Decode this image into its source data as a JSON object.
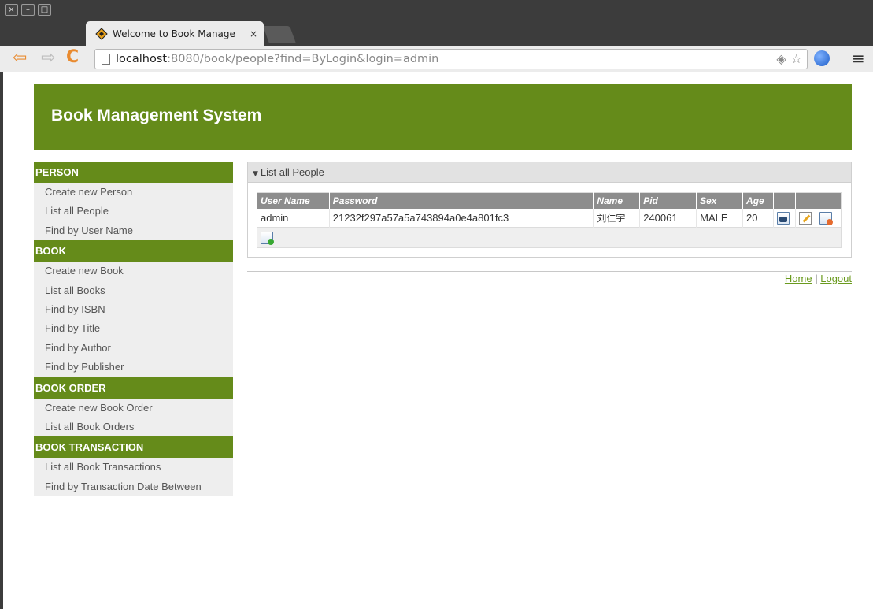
{
  "browser": {
    "window_buttons": [
      "×",
      "–",
      "□"
    ],
    "tab_title": "Welcome to Book Manage",
    "tab_close": "×",
    "url_host": "localhost",
    "url_rest": ":8080/book/people?find=ByLogin&login=admin",
    "menu_glyph": "≡"
  },
  "header": {
    "title": "Book Management System"
  },
  "sidebar": {
    "sections": [
      {
        "title": "PERSON",
        "items": [
          "Create new Person",
          "List all People",
          "Find by User Name"
        ]
      },
      {
        "title": "BOOK",
        "items": [
          "Create new Book",
          "List all Books",
          "Find by ISBN",
          "Find by Title",
          "Find by Author",
          "Find by Publisher"
        ]
      },
      {
        "title": "BOOK ORDER",
        "items": [
          "Create new Book Order",
          "List all Book Orders"
        ]
      },
      {
        "title": "BOOK TRANSACTION",
        "items": [
          "List all Book Transactions",
          "Find by Transaction Date Between"
        ]
      }
    ]
  },
  "panel": {
    "title": "List all People",
    "columns": [
      "User Name",
      "Password",
      "Name",
      "Pid",
      "Sex",
      "Age"
    ],
    "rows": [
      {
        "user_name": "admin",
        "password": "21232f297a57a5a743894a0e4a801fc3",
        "name": "刘仁宇",
        "pid": "240061",
        "sex": "MALE",
        "age": "20"
      }
    ]
  },
  "footer": {
    "home": "Home",
    "separator": "|",
    "logout": "Logout"
  },
  "icons": {
    "back": "back-arrow-icon",
    "forward": "forward-arrow-icon",
    "reload": "reload-icon",
    "show": "show-person-icon",
    "edit": "edit-person-icon",
    "delete": "delete-person-icon",
    "add": "add-person-icon"
  },
  "colors": {
    "brand": "#658b1a",
    "link": "#6a9a1e",
    "grid_header": "#8d8d8d"
  }
}
